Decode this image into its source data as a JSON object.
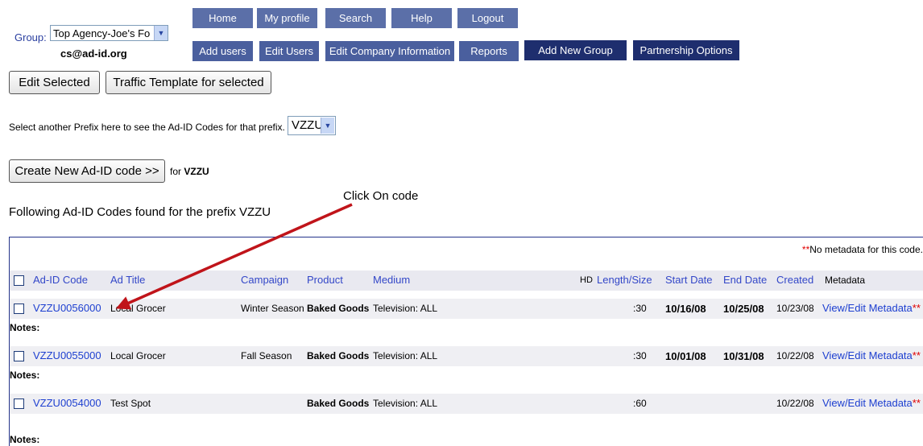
{
  "group": {
    "label": "Group:",
    "selected": "Top Agency-Joe's Fo",
    "user_email": "cs@ad-id.org"
  },
  "nav": {
    "row1": [
      "Home",
      "My profile",
      "Search",
      "Help",
      "Logout"
    ],
    "row2": [
      "Add users",
      "Edit Users",
      "Edit Company Information",
      "Reports",
      "Add New Group",
      "Partnership Options"
    ]
  },
  "actions": {
    "edit_selected": "Edit Selected",
    "traffic_template": "Traffic Template for selected"
  },
  "prefix": {
    "instruction": "Select another Prefix here to see the Ad-ID Codes for that prefix.",
    "selected": "VZZU"
  },
  "create": {
    "button": "Create New Ad-ID code >>",
    "for_label": "for",
    "prefix": "VZZU"
  },
  "results_title": "Following Ad-ID Codes found for the prefix VZZU",
  "annotation": "Click On code",
  "table": {
    "no_metadata_marker": "**",
    "no_metadata_note": "No metadata for this code.",
    "headers": {
      "code": "Ad-ID Code",
      "title": "Ad Title",
      "campaign": "Campaign",
      "product": "Product",
      "medium": "Medium",
      "hd": "HD",
      "length": "Length/Size",
      "start": "Start Date",
      "end": "End Date",
      "created": "Created",
      "metadata": "Metadata"
    },
    "notes_label": "Notes:",
    "rows": [
      {
        "code": "VZZU0056000",
        "title": "Local Grocer",
        "campaign": "Winter Season",
        "product": "Baked Goods",
        "medium": "Television: ALL",
        "length": ":30",
        "start": "10/16/08",
        "end": "10/25/08",
        "created": "10/23/08",
        "metadata": "View/Edit Metadata",
        "marker": "**"
      },
      {
        "code": "VZZU0055000",
        "title": "Local Grocer",
        "campaign": "Fall Season",
        "product": "Baked Goods",
        "medium": "Television: ALL",
        "length": ":30",
        "start": "10/01/08",
        "end": "10/31/08",
        "created": "10/22/08",
        "metadata": "View/Edit Metadata",
        "marker": "**"
      },
      {
        "code": "VZZU0054000",
        "title": "Test Spot",
        "campaign": "",
        "product": "Baked Goods",
        "medium": "Television: ALL",
        "length": ":60",
        "start": "",
        "end": "",
        "created": "10/22/08",
        "metadata": "View/Edit Metadata",
        "marker": "**"
      }
    ]
  },
  "colors": {
    "nav": "#4a5f9e",
    "nav_dark": "#1e2e6e",
    "link": "#1d3fd0",
    "arrow": "#c0141a",
    "marker": "#e00000"
  }
}
